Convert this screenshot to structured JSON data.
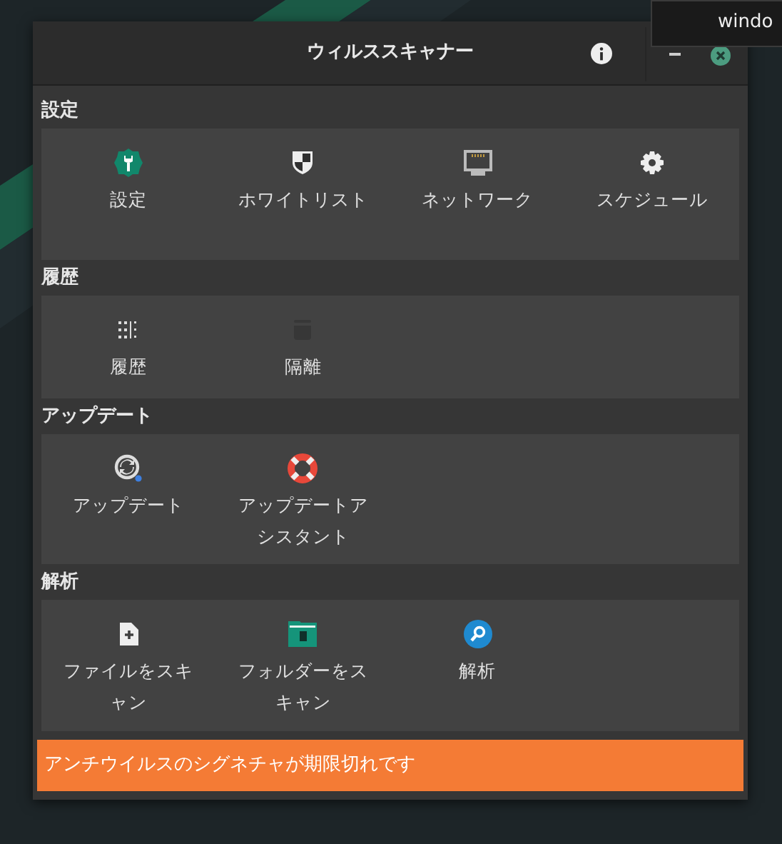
{
  "desktop": {
    "tooltip": "windo"
  },
  "window": {
    "title": "ウィルススキャナー"
  },
  "sections": [
    {
      "title": "設定",
      "items": [
        {
          "label": "設定",
          "kind": "wrench",
          "disabled": false
        },
        {
          "label": "ホワイトリスト",
          "kind": "shield",
          "disabled": false
        },
        {
          "label": "ネットワーク",
          "kind": "network",
          "disabled": false
        },
        {
          "label": "スケジュール",
          "kind": "gear",
          "disabled": false
        }
      ]
    },
    {
      "title": "履歴",
      "items": [
        {
          "label": "履歴",
          "kind": "list",
          "disabled": false
        },
        {
          "label": "隔離",
          "kind": "trash",
          "disabled": true
        }
      ]
    },
    {
      "title": "アップデート",
      "items": [
        {
          "label": "アップデート",
          "kind": "sync",
          "disabled": false
        },
        {
          "label": "アップデートアシスタント",
          "kind": "lifebuoy",
          "disabled": false
        }
      ]
    },
    {
      "title": "解析",
      "items": [
        {
          "label": "ファイルをスキャン",
          "kind": "file",
          "disabled": false
        },
        {
          "label": "フォルダーをスキャン",
          "kind": "folder",
          "disabled": false
        },
        {
          "label": "解析",
          "kind": "search",
          "disabled": false
        }
      ]
    }
  ],
  "status_bar": {
    "message": "アンチウイルスのシグネチャが期限切れです"
  }
}
